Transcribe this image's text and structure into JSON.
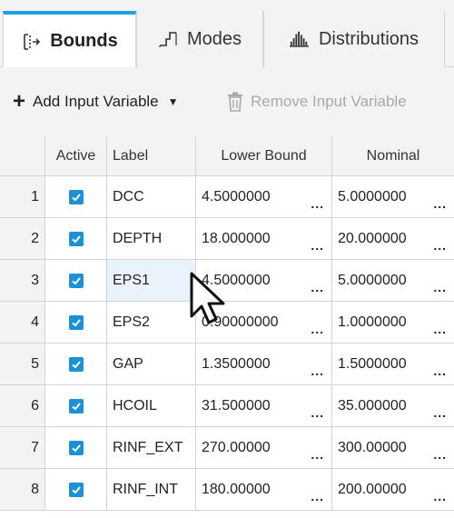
{
  "tabs": [
    {
      "label": "Bounds",
      "icon": "bounds-icon",
      "active": true
    },
    {
      "label": "Modes",
      "icon": "modes-icon",
      "active": false
    },
    {
      "label": "Distributions",
      "icon": "distributions-icon",
      "active": false
    }
  ],
  "toolbar": {
    "add_label": "Add Input Variable",
    "remove_label": "Remove Input Variable"
  },
  "table": {
    "headers": {
      "active": "Active",
      "label": "Label",
      "lower": "Lower Bound",
      "nominal": "Nominal"
    },
    "more_glyph": "...",
    "rows": [
      {
        "num": "1",
        "label": "DCC",
        "lower": "4.5000000",
        "nominal": "5.0000000",
        "checked": true
      },
      {
        "num": "2",
        "label": "DEPTH",
        "lower": "18.000000",
        "nominal": "20.000000",
        "checked": true
      },
      {
        "num": "3",
        "label": "EPS1",
        "lower": "4.5000000",
        "nominal": "5.0000000",
        "checked": true
      },
      {
        "num": "4",
        "label": "EPS2",
        "lower": "0.90000000",
        "nominal": "1.0000000",
        "checked": true
      },
      {
        "num": "5",
        "label": "GAP",
        "lower": "1.3500000",
        "nominal": "1.5000000",
        "checked": true
      },
      {
        "num": "6",
        "label": "HCOIL",
        "lower": "31.500000",
        "nominal": "35.000000",
        "checked": true
      },
      {
        "num": "7",
        "label": "RINF_EXT",
        "lower": "270.00000",
        "nominal": "300.00000",
        "checked": true
      },
      {
        "num": "8",
        "label": "RINF_INT",
        "lower": "180.00000",
        "nominal": "200.00000",
        "checked": true
      }
    ]
  },
  "colors": {
    "accent": "#1ba1e2",
    "checkbox": "#1e90d6"
  }
}
